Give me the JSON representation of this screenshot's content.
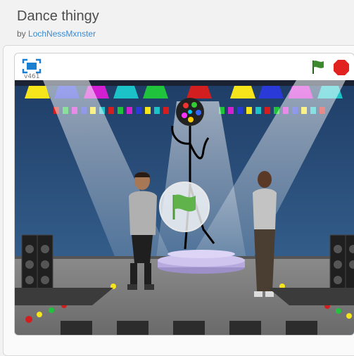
{
  "project": {
    "title": "Dance thingy",
    "by_label": "by",
    "author": "LochNessMxnster"
  },
  "player": {
    "version": "v461",
    "icons": {
      "fullscreen": "fullscreen-icon",
      "green_flag": "green-flag-icon",
      "stop": "stop-sign-icon",
      "play_overlay": "green-flag-icon"
    },
    "colors": {
      "fullscreen": "#1a7fd0",
      "flag": "#3d8a2e",
      "stop": "#e1221e",
      "play_overlay_flag": "#5fb34a"
    }
  }
}
